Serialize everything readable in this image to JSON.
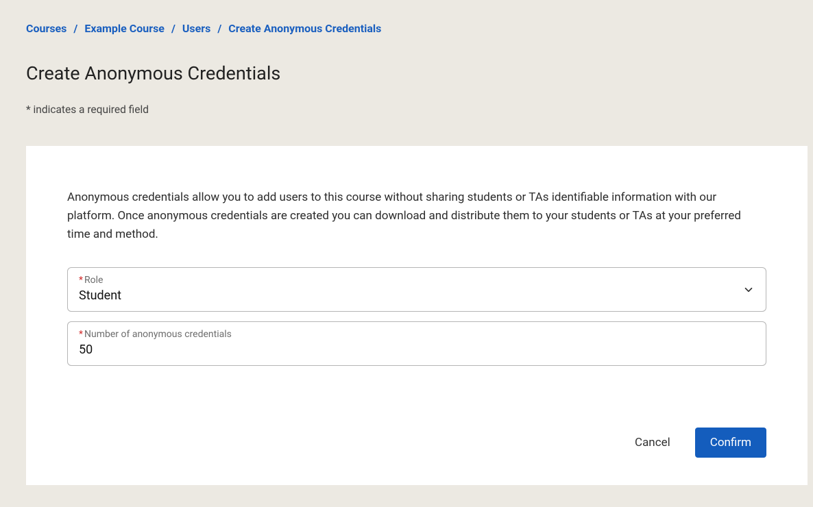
{
  "breadcrumb": {
    "items": [
      {
        "label": "Courses"
      },
      {
        "label": "Example Course"
      },
      {
        "label": "Users"
      },
      {
        "label": "Create Anonymous Credentials"
      }
    ],
    "separator": "/"
  },
  "page_title": "Create Anonymous Credentials",
  "required_note": "* indicates a required field",
  "form": {
    "description": "Anonymous credentials allow you to add users to this course without sharing students or TAs identifiable information with our platform. Once anonymous credentials are created you can download and distribute them to your students or TAs at your preferred time and method.",
    "role": {
      "label": "Role",
      "value": "Student"
    },
    "count": {
      "label": "Number of anonymous credentials",
      "value": "50"
    }
  },
  "actions": {
    "cancel": "Cancel",
    "confirm": "Confirm"
  }
}
